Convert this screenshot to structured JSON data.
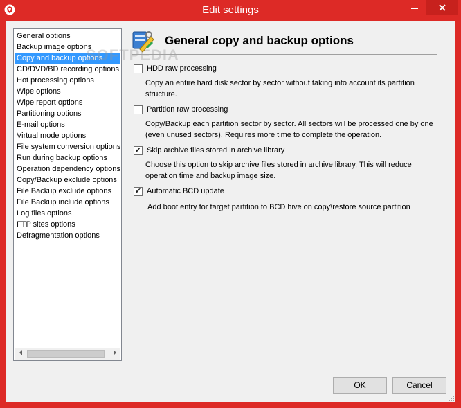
{
  "window": {
    "title": "Edit settings"
  },
  "nav": {
    "items": [
      {
        "label": "General options",
        "selected": false
      },
      {
        "label": "Backup image options",
        "selected": false
      },
      {
        "label": "Copy and backup options",
        "selected": true
      },
      {
        "label": "CD/DVD/BD recording options",
        "selected": false
      },
      {
        "label": "Hot processing options",
        "selected": false
      },
      {
        "label": "Wipe options",
        "selected": false
      },
      {
        "label": "Wipe report options",
        "selected": false
      },
      {
        "label": "Partitioning options",
        "selected": false
      },
      {
        "label": "E-mail options",
        "selected": false
      },
      {
        "label": "Virtual mode options",
        "selected": false
      },
      {
        "label": "File system conversion options",
        "selected": false
      },
      {
        "label": "Run during backup options",
        "selected": false
      },
      {
        "label": "Operation dependency options",
        "selected": false
      },
      {
        "label": "Copy/Backup exclude options",
        "selected": false
      },
      {
        "label": "File Backup exclude options",
        "selected": false
      },
      {
        "label": "File Backup include options",
        "selected": false
      },
      {
        "label": "Log files options",
        "selected": false
      },
      {
        "label": "FTP sites options",
        "selected": false
      },
      {
        "label": "Defragmentation options",
        "selected": false
      }
    ]
  },
  "main": {
    "title": "General copy and backup options",
    "watermark": "SOFTPEDIA",
    "options": [
      {
        "label": "HDD raw processing",
        "checked": false,
        "description": "Copy an entire hard disk sector by sector without taking into account its partition structure."
      },
      {
        "label": "Partition raw processing",
        "checked": false,
        "description": "Copy/Backup each partition sector by sector. All sectors will be processed one by one (even unused sectors). Requires more time to complete the operation."
      },
      {
        "label": "Skip archive files stored in archive library",
        "checked": true,
        "description": "Choose this option to skip archive files stored in archive library, This will reduce operation time and backup image size."
      },
      {
        "label": "Automatic BCD update",
        "checked": true,
        "description": "Add boot entry for target partition to BCD hive on copy\\restore source partition"
      }
    ]
  },
  "buttons": {
    "ok": "OK",
    "cancel": "Cancel"
  },
  "colors": {
    "titlebar": "#dd2a26",
    "selection": "#3399ff"
  }
}
